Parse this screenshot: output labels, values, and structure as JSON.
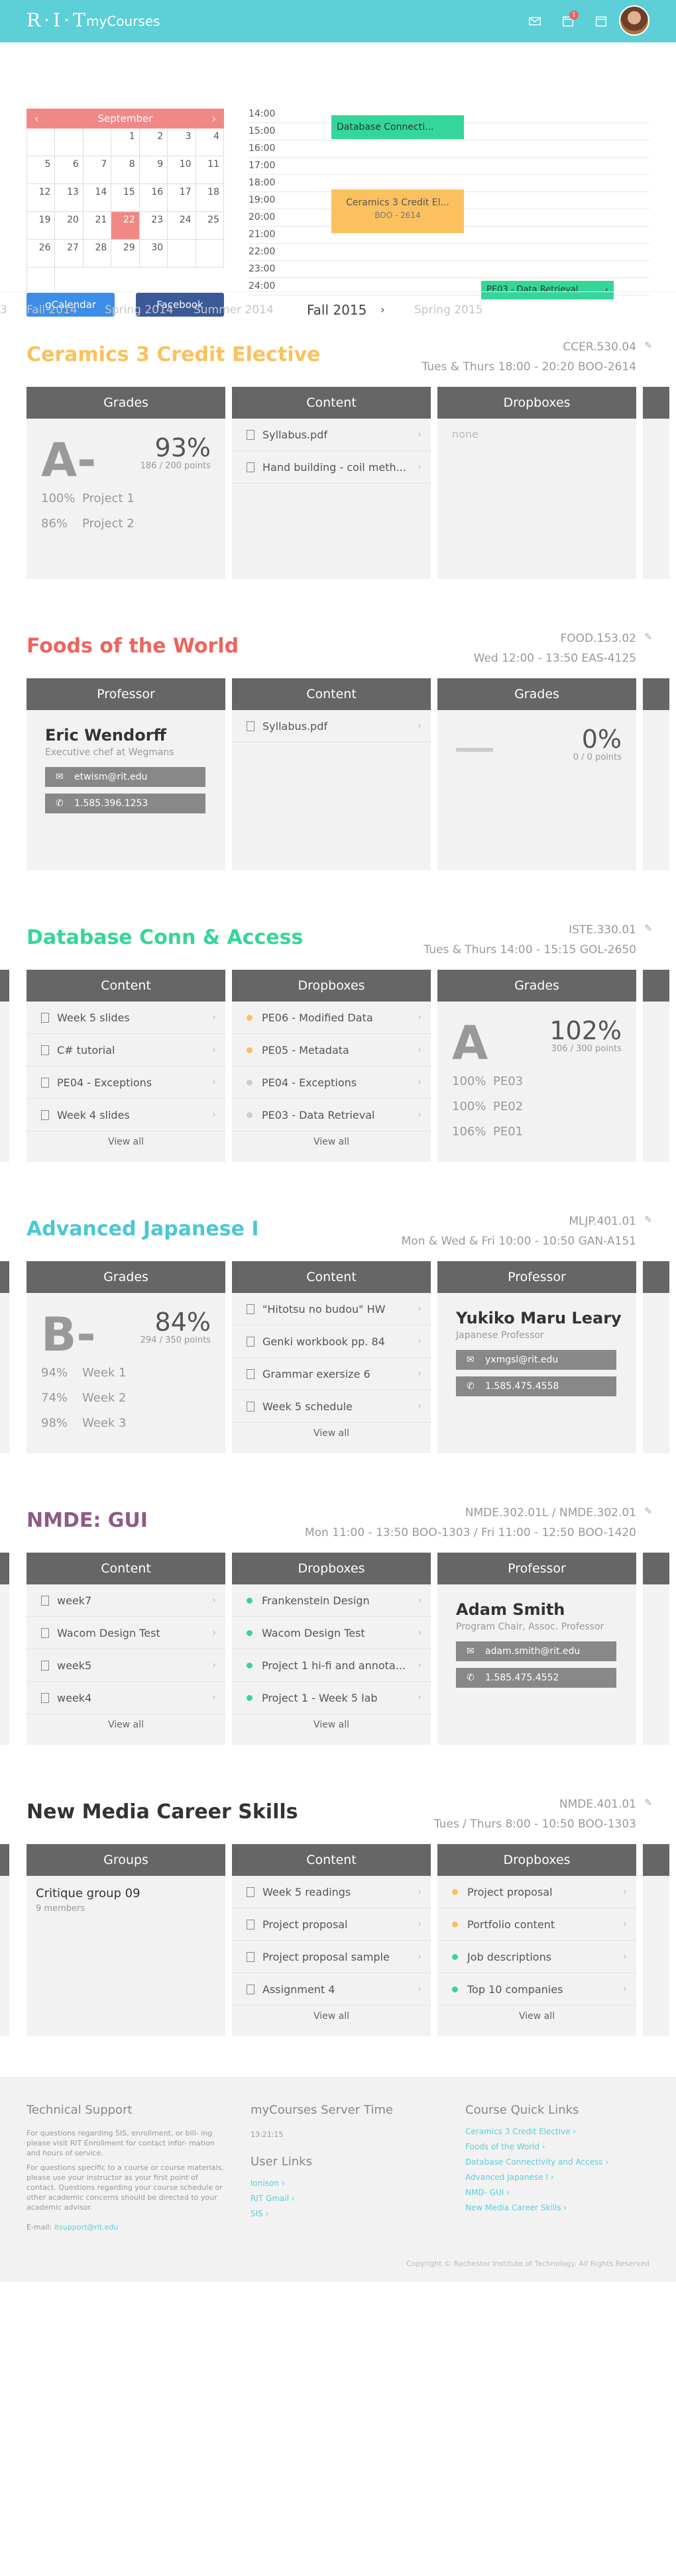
{
  "header": {
    "logo": "R·I·T",
    "app": "myCourses",
    "notif_count": "1"
  },
  "calendar": {
    "month": "September",
    "prev": "‹",
    "next": "›",
    "days": [
      "",
      "",
      "",
      "1",
      "2",
      "3",
      "4",
      "5",
      "6",
      "7",
      "8",
      "9",
      "10",
      "11",
      "12",
      "13",
      "14",
      "15",
      "16",
      "17",
      "18",
      "19",
      "20",
      "21",
      "22",
      "23",
      "24",
      "25",
      "26",
      "27",
      "28",
      "29",
      "30",
      "",
      "",
      ""
    ],
    "today": "22"
  },
  "buttons": {
    "gcal": "gCalendar",
    "facebook": "Facebook"
  },
  "timeline": {
    "hours": [
      "14:00",
      "15:00",
      "16:00",
      "17:00",
      "18:00",
      "19:00",
      "20:00",
      "21:00",
      "22:00",
      "23:00",
      "24:00"
    ],
    "events": [
      {
        "label": "Database Connecti...",
        "color": "#35d69a"
      },
      {
        "label": "Ceramics 3 Credit El...",
        "sub": "BOO - 2614",
        "color": "#fbc15e"
      },
      {
        "label": "PE03 - Data Retrieval",
        "color": "#35d69a"
      }
    ]
  },
  "semesters": [
    "3",
    "Fall 2014",
    "Spring 2014",
    "Summer 2014",
    "Fall 2015",
    "Spring 2015"
  ],
  "courses": [
    {
      "title": "Ceramics 3 Credit Elective",
      "color": "#fbc15e",
      "code": "CCER.530.04",
      "time": "Tues & Thurs 18:00 - 20:20 BOO-2614",
      "grades": {
        "head": "Grades",
        "letter": "A-",
        "pct": "93%",
        "pts": "186 / 200 points",
        "lines": [
          [
            "100%",
            "Project 1"
          ],
          [
            "86%",
            "Project 2"
          ]
        ]
      },
      "content": {
        "head": "Content",
        "items": [
          "Syllabus.pdf",
          "Hand building - coil meth..."
        ]
      },
      "drop": {
        "head": "Dropboxes",
        "none": "none"
      }
    },
    {
      "title": "Foods of the World",
      "color": "#f0645c",
      "code": "FOOD.153.02",
      "time": "Wed 12:00 - 13:50 EAS-4125",
      "prof": {
        "head": "Professor",
        "name": "Eric Wendorff",
        "role": "Executive chef at Wegmans",
        "email": "etwism@rit.edu",
        "phone": "1.585.396.1253"
      },
      "content": {
        "head": "Content",
        "items": [
          "Syllabus.pdf"
        ]
      },
      "grades": {
        "head": "Grades",
        "pct": "0%",
        "pts": "0 / 0 points"
      }
    },
    {
      "title": "Database Conn & Access",
      "color": "#35d69a",
      "code": "ISTE.330.01",
      "time": "Tues & Thurs 14:00 - 15:15 GOL-2650",
      "content": {
        "head": "Content",
        "items": [
          "Week 5 slides",
          "C# tutorial",
          "PE04 - Exceptions",
          "Week 4 slides"
        ],
        "viewall": "View all"
      },
      "drop": {
        "head": "Dropboxes",
        "items": [
          [
            "PE06 - Modified Data",
            "#fbc15e"
          ],
          [
            "PE05 - Metadata",
            "#fbc15e"
          ],
          [
            "PE04 - Exceptions",
            "#ccc"
          ],
          [
            "PE03 - Data Retrieval",
            "#ccc"
          ]
        ],
        "viewall": "View all"
      },
      "grades": {
        "head": "Grades",
        "letter": "A",
        "pct": "102%",
        "pts": "306 / 300 points",
        "lines": [
          [
            "100%",
            "PE03"
          ],
          [
            "100%",
            "PE02"
          ],
          [
            "106%",
            "PE01"
          ]
        ]
      }
    },
    {
      "title": "Advanced Japanese I",
      "color": "#4cc7d4",
      "code": "MLJP.401.01",
      "time": "Mon & Wed & Fri 10:00 - 10:50 GAN-A151",
      "grades": {
        "head": "Grades",
        "letter": "B-",
        "pct": "84%",
        "pts": "294 / 350 points",
        "lines": [
          [
            "94%",
            "Week 1"
          ],
          [
            "74%",
            "Week 2"
          ],
          [
            "98%",
            "Week 3"
          ]
        ]
      },
      "content": {
        "head": "Content",
        "items": [
          "\"Hitotsu no budou\" HW",
          "Genki workbook pp. 84",
          "Grammar exersize 6",
          "Week 5 schedule"
        ],
        "viewall": "View all"
      },
      "prof": {
        "head": "Professor",
        "name": "Yukiko Maru Leary",
        "role": "Japanese Professor",
        "email": "yxmgsl@rit.edu",
        "phone": "1.585.475.4558"
      }
    },
    {
      "title": "NMDE: GUI",
      "color": "#8f5a85",
      "code": "NMDE.302.01L / NMDE.302.01",
      "time": "Mon 11:00 - 13:50 BOO-1303 / Fri 11:00 - 12:50 BOO-1420",
      "content": {
        "head": "Content",
        "items": [
          "week7",
          "Wacom Design Test",
          "week5",
          "week4"
        ],
        "viewall": "View all"
      },
      "drop": {
        "head": "Dropboxes",
        "items": [
          [
            "Frankenstein Design",
            "#35d69a"
          ],
          [
            "Wacom Design Test",
            "#35d69a"
          ],
          [
            "Project 1 hi-fi and annota...",
            "#35d69a"
          ],
          [
            "Project 1 - Week 5 lab",
            "#35d69a"
          ]
        ],
        "viewall": "View all"
      },
      "prof": {
        "head": "Professor",
        "name": "Adam Smith",
        "role": "Program Chair, Assoc. Professor",
        "email": "adam.smith@rit.edu",
        "phone": "1.585.475.4552"
      }
    },
    {
      "title": "New Media Career Skills",
      "color": "#333333",
      "code": "NMDE.401.01",
      "time": "Tues / Thurs 8:00 - 10:50 BOO-1303",
      "groups": {
        "head": "Groups",
        "name": "Critique group 09",
        "members": "9 members"
      },
      "content": {
        "head": "Content",
        "items": [
          "Week 5 readings",
          "Project proposal",
          "Project proposal sample",
          "Assignment 4"
        ],
        "viewall": "View all"
      },
      "drop": {
        "head": "Dropboxes",
        "items": [
          [
            "Project proposal",
            "#fbc15e"
          ],
          [
            "Portfolio content",
            "#fbc15e"
          ],
          [
            "Job descriptions",
            "#35d69a"
          ],
          [
            "Top 10 companies",
            "#35d69a"
          ]
        ],
        "viewall": "View all"
      }
    }
  ],
  "footer": {
    "support_head": "Technical Support",
    "support_p1": "For questions regarding SIS, enrollment, or bill- ing please visit RIT Enrollment for contact infor- mation and hours of service.",
    "support_p2": "For questions specific to a course or course materials, please use your instructor as your first point of contact. Questions regarding your course schedule or other academic concerns should be directed to your academic advisor.",
    "email_label": "E-mail: ",
    "email": "itsupport@rit.edu",
    "server_head": "myCourses Server Time",
    "server_time": "13:21:15",
    "links_head": "User Links",
    "links": [
      "Ionison ›",
      "RIT Gmail ›",
      "SIS ›"
    ],
    "quick_head": "Course Quick Links",
    "quick": [
      "Ceramics 3 Credit Elective ›",
      "Foods of the World ›",
      "Database Connectivity and Access ›",
      "Advanced Japanese I ›",
      "NMD- GUI ›",
      "New Media Career Skills ›"
    ],
    "copyright": "Copyright © Rochester Institute of Technology. All Rights Reserved"
  }
}
